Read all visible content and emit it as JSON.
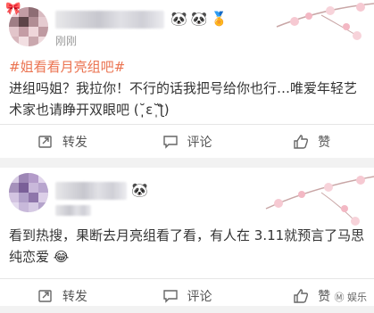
{
  "posts": [
    {
      "time": "刚刚",
      "hashtag": "#姐看看月亮组吧#",
      "text": "进组吗姐？我拉你！不行的话我把号给你也行…唯爱年轻艺术家也请睁开双眼吧 (˘̩̩̩ε˘̩ƪ)",
      "badges": [
        "🐼",
        "🐼",
        "🏅"
      ],
      "actions": {
        "repost": "转发",
        "comment": "评论",
        "like": "赞"
      }
    },
    {
      "text": "看到热搜，果断去月亮组看了看，有人在 3.11就预言了马思纯恋爱",
      "emoji": "😂",
      "badges": [
        "🐼"
      ],
      "actions": {
        "repost": "转发",
        "comment": "评论",
        "like": "赞"
      }
    }
  ],
  "watermark": "Ⓜ 娱乐"
}
